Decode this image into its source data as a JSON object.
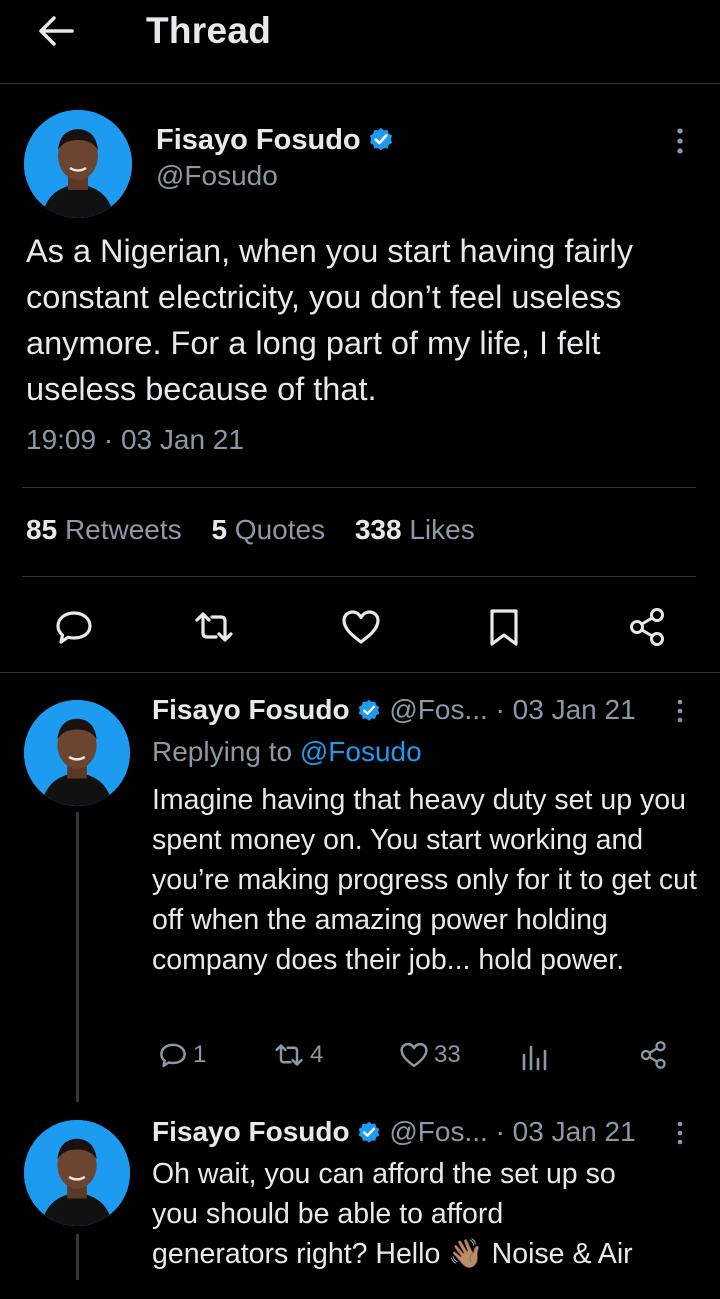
{
  "header": {
    "title": "Thread",
    "back_icon": "arrow-left-icon"
  },
  "colors": {
    "background": "#000000",
    "text": "#e7e9ea",
    "muted": "#8b98a5",
    "accent": "#1d9bf0",
    "divider": "#2f3336"
  },
  "main_tweet": {
    "author_name": "Fisayo Fosudo",
    "handle": "@Fosudo",
    "verified": true,
    "text": "As a Nigerian, when you start having fairly constant electricity, you don’t feel useless anymore. For a long part of my life, I felt useless because of that.",
    "timestamp": "19:09 · 03 Jan 21",
    "stats": {
      "retweets_count": "85",
      "retweets_label": "Retweets",
      "quotes_count": "5",
      "quotes_label": "Quotes",
      "likes_count": "338",
      "likes_label": "Likes"
    },
    "actions": [
      "reply-icon",
      "retweet-icon",
      "like-icon",
      "bookmark-icon",
      "share-icon"
    ]
  },
  "replies": [
    {
      "author_name": "Fisayo Fosudo",
      "handle": "@Fos...",
      "date": "· 03 Jan 21",
      "replying_prefix": "Replying to",
      "replying_to": "@Fosudo",
      "text": "Imagine having that heavy duty set up you spent money on. You start working and you’re making progress only for it to get cut off when the amazing power holding company does their job... hold power.",
      "reply_count": "1",
      "retweet_count": "4",
      "like_count": "33"
    },
    {
      "author_name": "Fisayo Fosudo",
      "handle": "@Fos...",
      "date": "· 03 Jan 21",
      "text_line1": "Oh wait, you can afford the set up so",
      "text_line2": "you should be able to afford",
      "text_line3a": "generators right? Hello",
      "emoji": "👋🏽",
      "text_line3b": "Noise & Air"
    }
  ]
}
